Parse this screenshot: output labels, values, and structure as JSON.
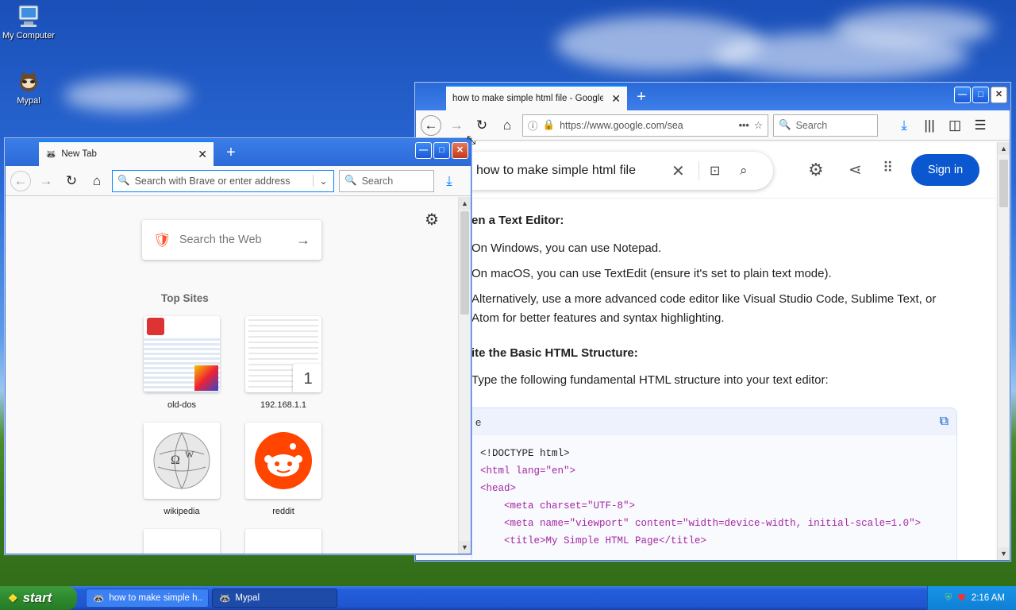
{
  "desktop": {
    "icons": [
      {
        "label": "My Computer",
        "icon": "computer-icon"
      },
      {
        "label": "Mypal",
        "icon": "mypal-icon"
      }
    ]
  },
  "left_window": {
    "tab_title": "New Tab",
    "address_placeholder": "Search with Brave or enter address",
    "search_placeholder": "Search",
    "search_the_web": "Search the Web",
    "top_sites_label": "Top Sites",
    "sites": [
      {
        "label": "old-dos"
      },
      {
        "label": "192.168.1.1",
        "badge": "1"
      },
      {
        "label": "wikipedia"
      },
      {
        "label": "reddit"
      }
    ]
  },
  "right_window": {
    "tab_title": "how to make simple html file - Google S",
    "url": "https://www.google.com/sea",
    "search_placeholder": "Search",
    "query": "how to make simple html file",
    "sign_in": "Sign in",
    "step1_heading": "en a Text Editor:",
    "bullets1": [
      "On Windows, you can use Notepad.",
      "On macOS, you can use TextEdit (ensure it's set to plain text mode).",
      "Alternatively, use a more advanced code editor like Visual Studio Code, Sublime Text, or",
      "Atom for better features and syntax highlighting."
    ],
    "step2_heading": "ite the Basic HTML Structure:",
    "step2_text": "Type the following fundamental HTML structure into your text editor:",
    "code_label": "e",
    "code_lines": [
      "<!DOCTYPE html>",
      "<html lang=\"en\">",
      "<head>",
      "    <meta charset=\"UTF-8\">",
      "    <meta name=\"viewport\" content=\"width=device-width, initial-scale=1.0\">",
      "    <title>My Simple HTML Page</title>"
    ]
  },
  "taskbar": {
    "start_label": "start",
    "tasks": [
      {
        "label": "how to make simple h..."
      },
      {
        "label": "Mypal"
      }
    ],
    "clock": "2:16 AM"
  }
}
